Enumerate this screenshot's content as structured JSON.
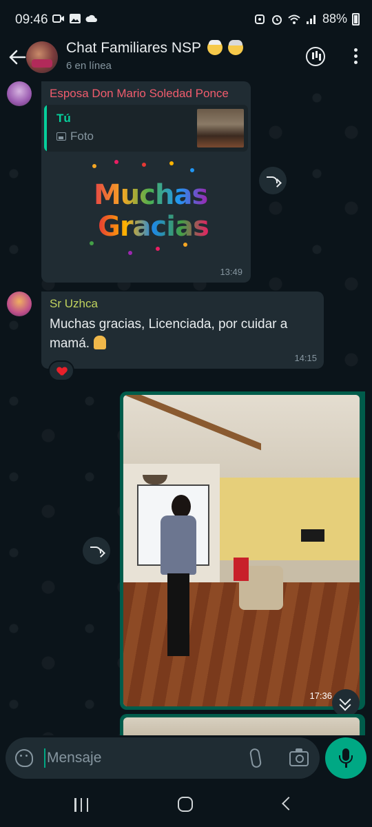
{
  "status_bar": {
    "time": "09:46",
    "battery": "88%",
    "left_icons": [
      "video-icon",
      "gallery-icon",
      "cloud-icon"
    ],
    "right_icons": [
      "mute-icon",
      "alarm-icon",
      "wifi-icon",
      "signal-icon",
      "battery-icon"
    ]
  },
  "header": {
    "title": "Chat Familiares NSP",
    "title_emojis": [
      "older-man-emoji",
      "older-woman-emoji"
    ],
    "subtitle": "6 en línea"
  },
  "messages": [
    {
      "sender": "Esposa Don Mario Soledad Ponce",
      "sender_color": "#f15c6d",
      "quote": {
        "name": "Tú",
        "type": "Foto"
      },
      "sticker": {
        "line1": "Muchas",
        "line2": "Gracias"
      },
      "time": "13:49"
    },
    {
      "sender": "Sr Uzhca",
      "sender_color": "#c1d35e",
      "text": "Muchas gracias, Licenciada, por cuidar a mamá.",
      "emoji": "folded-hands-emoji",
      "time": "14:15",
      "reaction": "heart"
    },
    {
      "type": "photo",
      "outgoing": true,
      "time": "17:36"
    }
  ],
  "input": {
    "placeholder": "Mensaje"
  },
  "colors": {
    "background": "#0b141a",
    "incoming_bubble": "#202c33",
    "outgoing_bubble": "#005c4b",
    "accent": "#00a884"
  }
}
